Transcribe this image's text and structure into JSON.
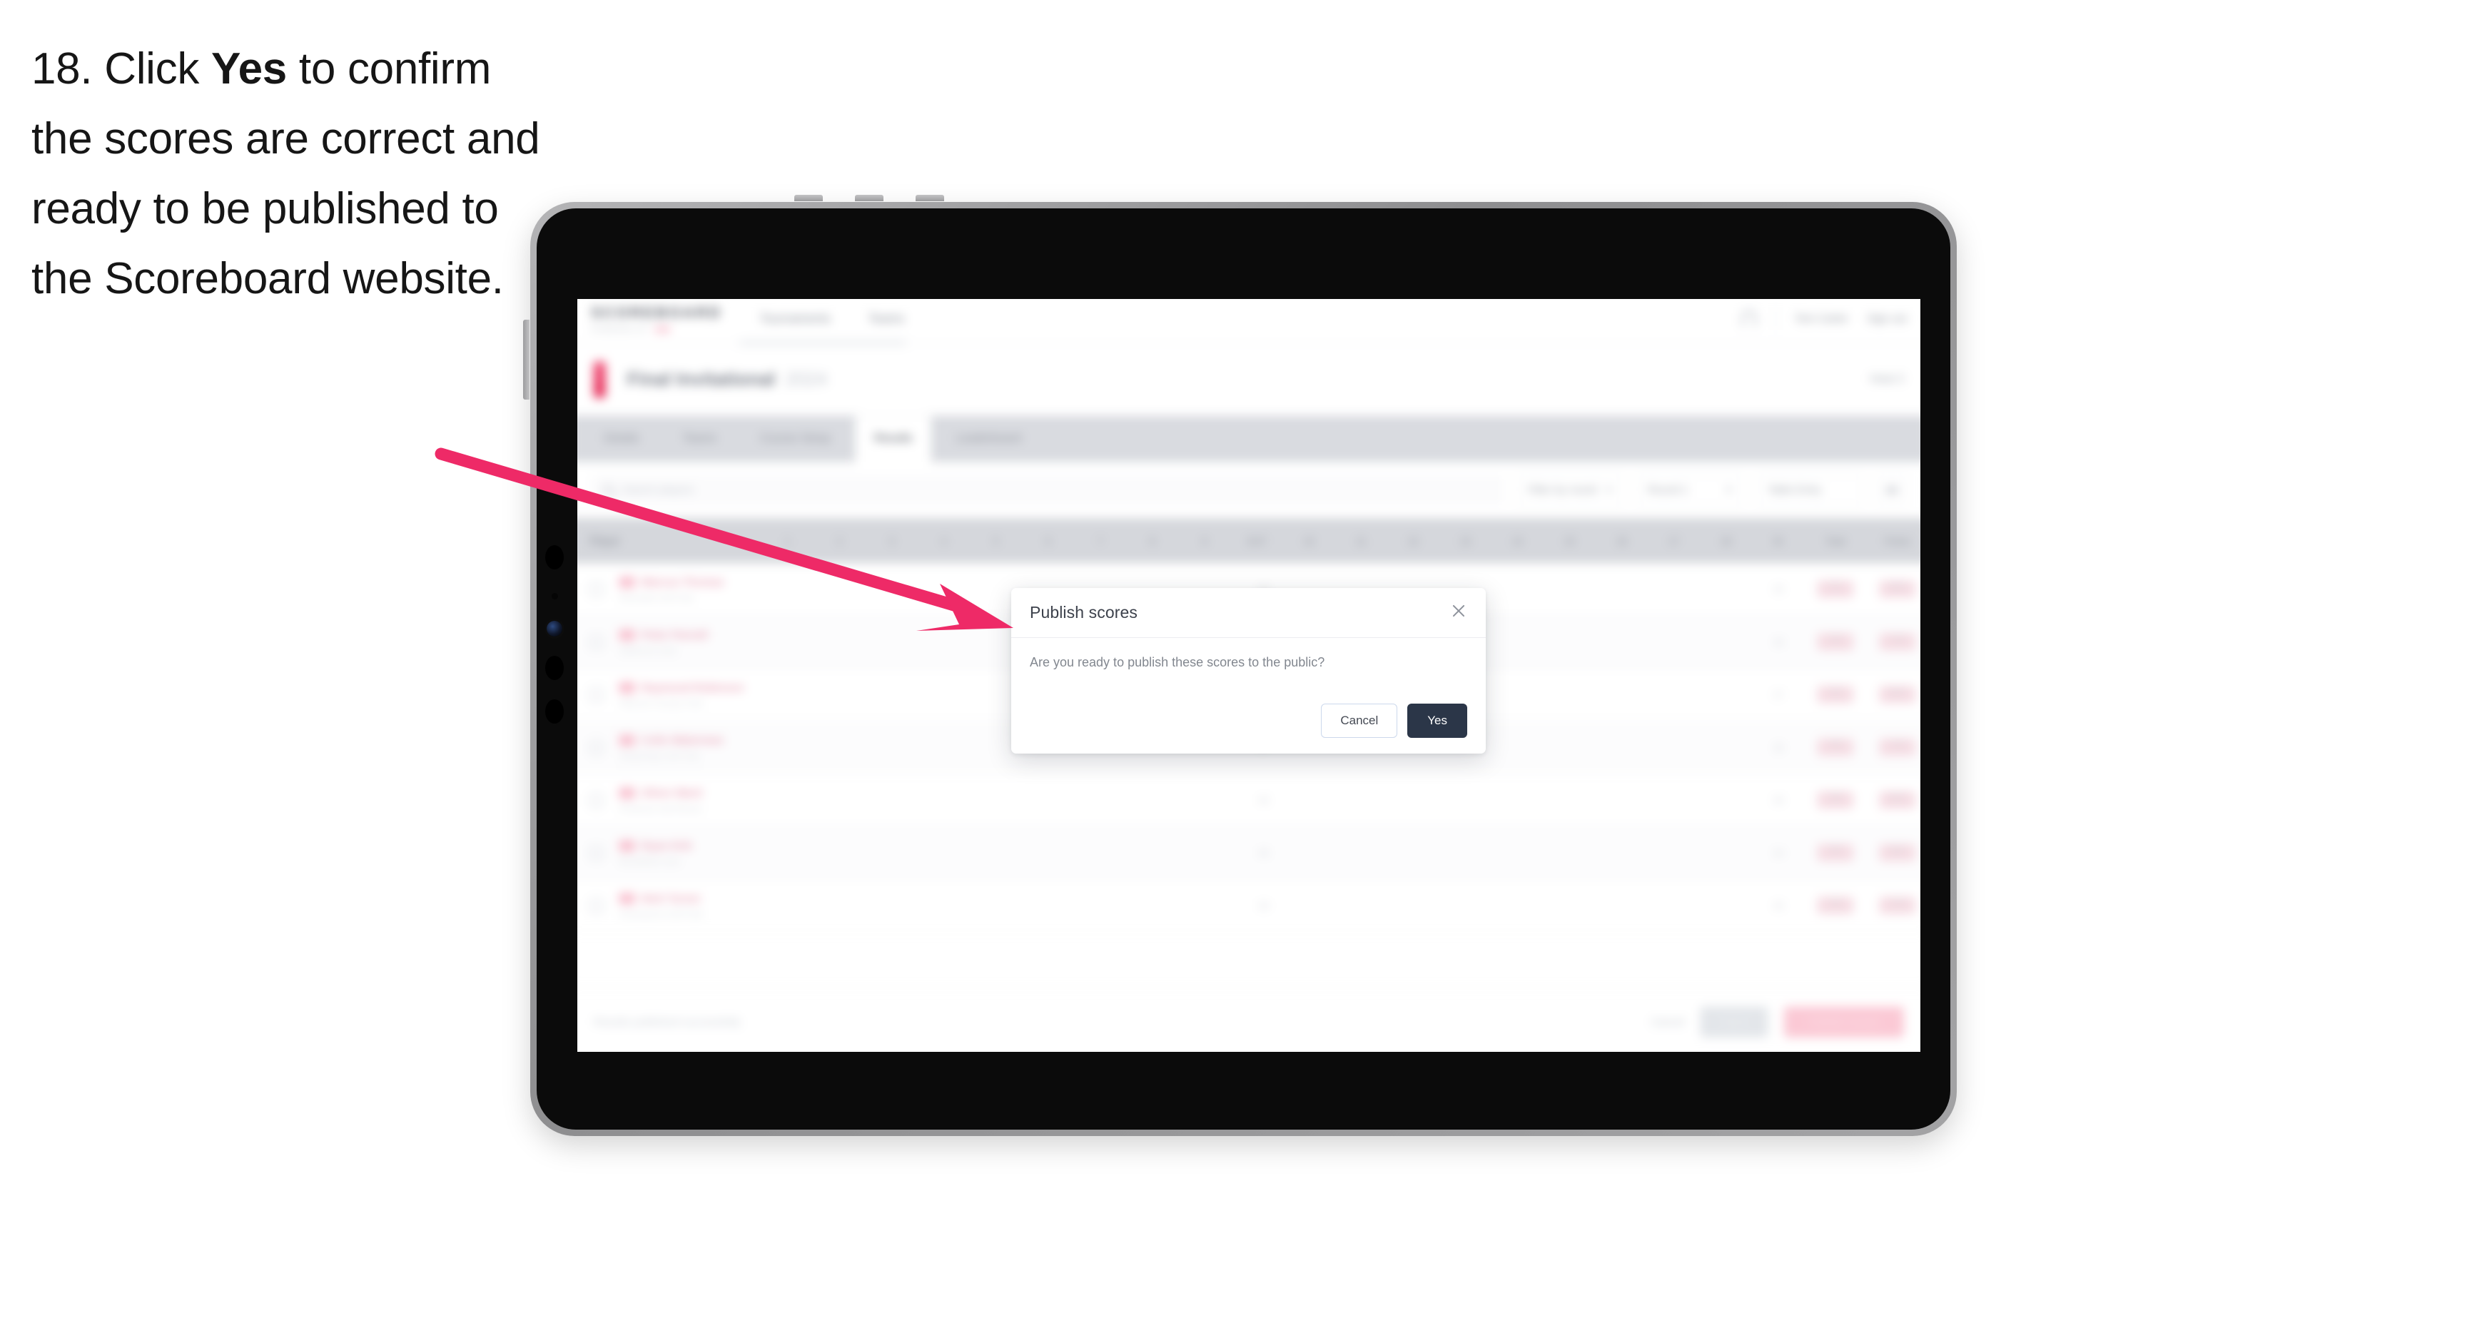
{
  "instruction": {
    "step_number": "18.",
    "before_bold": " Click ",
    "bold": "Yes",
    "after_bold": " to confirm the scores are correct and ready to be published to the Scoreboard website."
  },
  "colors": {
    "arrow": "#ee2a67",
    "yes_button_bg": "#2b3648",
    "cancel_border": "#ccd8ec",
    "brand_accent": "#e4214f",
    "tabbar_bg": "#d9dbe0",
    "table_header_bg": "#d5d7dc"
  },
  "modal": {
    "title": "Publish scores",
    "body": "Are you ready to publish these scores to the public?",
    "close_icon": "close-x-icon",
    "cancel_label": "Cancel",
    "yes_label": "Yes"
  },
  "app": {
    "brand": {
      "wordmark": "SCOREBOARD",
      "subtext": "POWERED BY"
    },
    "nav_links": [
      "Tournaments",
      "Teams"
    ],
    "nav_right": {
      "bell_icon": "bell-icon",
      "user": "Tom Carter",
      "signout": "Sign out"
    },
    "sub_header": {
      "title": "Final Invitational",
      "subtitle": "2024",
      "right": "Heat 3"
    },
    "tabs": [
      {
        "label": "Details",
        "active": false
      },
      {
        "label": "Teams",
        "active": false
      },
      {
        "label": "Course Setup",
        "active": false
      },
      {
        "label": "Results",
        "active": true
      },
      {
        "label": "Leaderboard",
        "active": false
      }
    ],
    "toolbar": {
      "search_placeholder": "Search players",
      "filters": [
        "Filter by round",
        "Round 1",
        "Table Entry"
      ],
      "settings_icon": "sliders-icon"
    },
    "table": {
      "columns_player": "Player",
      "columns_holes": [
        "1",
        "2",
        "3",
        "4",
        "5",
        "6",
        "7",
        "8",
        "9",
        "OUT",
        "10",
        "11",
        "12",
        "13",
        "14",
        "15",
        "16",
        "17",
        "18",
        "IN"
      ],
      "columns_end": [
        "Total",
        "Points"
      ],
      "rows": [
        {
          "name": "Marcus Thomas",
          "meta": "Riverside Golf Club",
          "out": "36",
          "in": "35",
          "total": "71",
          "points": "8.5"
        },
        {
          "name": "Peter Parnell",
          "meta": "Oakmont Links",
          "out": "38",
          "in": "36",
          "total": "74",
          "points": "7.5"
        },
        {
          "name": "Raymond Robinson",
          "meta": "Hillcrest Country Club",
          "out": "35",
          "in": "37",
          "total": "72",
          "points": "8.0"
        },
        {
          "name": "Colin Waterman",
          "meta": "Sandy Bay Golf Club",
          "out": "37",
          "in": "38",
          "total": "75",
          "points": "7.0"
        },
        {
          "name": "Oliver Ward",
          "meta": "Pinehurst Golf Resort",
          "out": "40",
          "in": "36",
          "total": "76",
          "points": "6.5"
        },
        {
          "name": "Ryan Kirk",
          "meta": "Brookfield Links",
          "out": "36",
          "in": "34",
          "total": "70",
          "points": "9.0"
        },
        {
          "name": "Nick Turner",
          "meta": "Greenacres Golf Club",
          "out": "39",
          "in": "35",
          "total": "74",
          "points": "7.5"
        }
      ]
    },
    "footer": {
      "note": "Results published successfully",
      "link_label": "Cancel",
      "secondary_label": "Save",
      "primary_label": "Publish scores"
    }
  }
}
